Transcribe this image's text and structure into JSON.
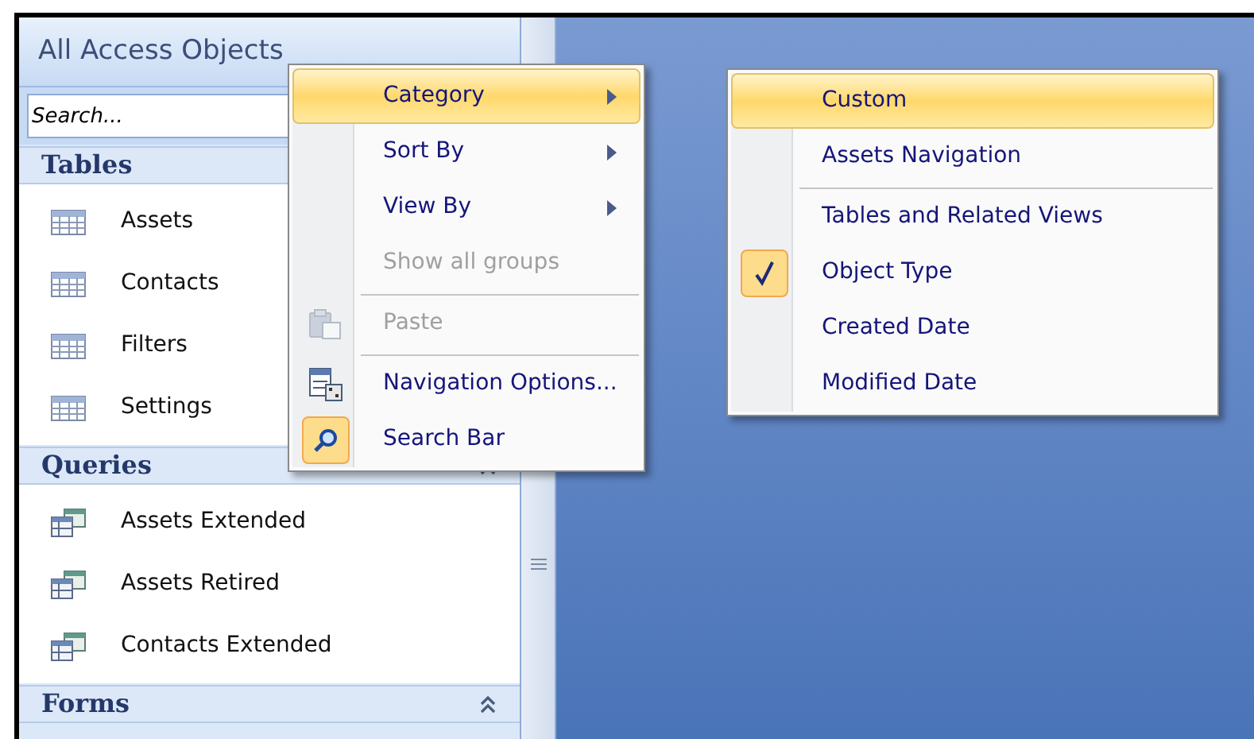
{
  "nav_pane": {
    "title": "All Access Objects",
    "search": {
      "placeholder": "Search..."
    },
    "groups": [
      {
        "title": "Tables",
        "kind": "tables",
        "items": [
          "Assets",
          "Contacts",
          "Filters",
          "Settings"
        ]
      },
      {
        "title": "Queries",
        "kind": "queries",
        "items": [
          "Assets Extended",
          "Assets Retired",
          "Contacts Extended"
        ]
      },
      {
        "title": "Forms",
        "kind": "forms"
      }
    ]
  },
  "context_menu": {
    "items": [
      {
        "label": "Category",
        "kind": "submenu",
        "selected": true,
        "disabled": false,
        "divider_above": false,
        "checked": false
      },
      {
        "label": "Sort By",
        "kind": "submenu",
        "selected": false,
        "disabled": false,
        "divider_above": false,
        "checked": false
      },
      {
        "label": "View By",
        "kind": "submenu",
        "selected": false,
        "disabled": false,
        "divider_above": false,
        "checked": false
      },
      {
        "label": "Show all groups",
        "kind": "command",
        "selected": false,
        "disabled": true,
        "divider_above": false,
        "checked": false
      },
      {
        "label": "Paste",
        "kind": "paste",
        "selected": false,
        "disabled": true,
        "divider_above": true,
        "checked": false
      },
      {
        "label": "Navigation Options...",
        "kind": "options",
        "selected": false,
        "disabled": false,
        "divider_above": true,
        "checked": false
      },
      {
        "label": "Search Bar",
        "kind": "search",
        "selected": false,
        "disabled": false,
        "divider_above": false,
        "checked": true
      }
    ]
  },
  "submenu": {
    "items": [
      {
        "label": "Custom",
        "selected": true,
        "checked": false,
        "divider_above": false
      },
      {
        "label": "Assets Navigation",
        "selected": false,
        "checked": false,
        "divider_above": false
      },
      {
        "label": "Tables and Related Views",
        "selected": false,
        "checked": false,
        "divider_above": true
      },
      {
        "label": "Object Type",
        "selected": false,
        "checked": true,
        "divider_above": false
      },
      {
        "label": "Created Date",
        "selected": false,
        "checked": false,
        "divider_above": false
      },
      {
        "label": "Modified Date",
        "selected": false,
        "checked": false,
        "divider_above": false
      }
    ]
  }
}
